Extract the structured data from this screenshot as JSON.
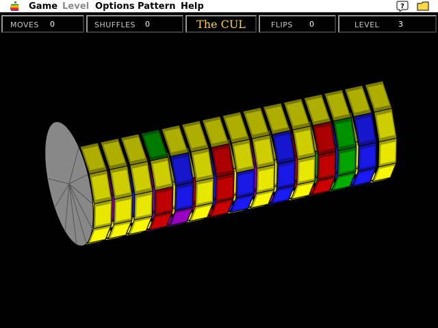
{
  "menubar": {
    "items": [
      {
        "label": "Game",
        "enabled": true
      },
      {
        "label": "Level",
        "enabled": false
      },
      {
        "label": "Options",
        "enabled": true
      },
      {
        "label": "Pattern",
        "enabled": true
      },
      {
        "label": "Help",
        "enabled": true
      }
    ],
    "right_icons": [
      "help-icon",
      "finder-icon"
    ]
  },
  "status": {
    "moves_label": "MOVES",
    "moves_value": "0",
    "shuffles_label": "SHUFFLES",
    "shuffles_value": "0",
    "title": "The CUL",
    "flips_label": "FLIPS",
    "flips_value": "0",
    "level_label": "LEVEL",
    "level_value": "3"
  },
  "colors": {
    "yellow": "#ffff00",
    "purple": "#9b00c8",
    "blue": "#1b1bff",
    "red": "#d20000",
    "green": "#00b400",
    "endcap": "#888888",
    "background": "#000000"
  },
  "cylinder": {
    "rings": [
      [
        "Y",
        "Y",
        "Y",
        "Y",
        "Y",
        "Y",
        "Y",
        "Y"
      ],
      [
        "Y",
        "Y",
        "Y",
        "Y",
        "Y",
        "Y",
        "Y",
        "Y"
      ],
      [
        "P",
        "P",
        "Y",
        "Y",
        "Y",
        "Y",
        "Y",
        "Y"
      ],
      [
        "B",
        "B",
        "Y",
        "P",
        "R",
        "R",
        "Y",
        "G"
      ],
      [
        "P",
        "P",
        "P",
        "P",
        "P",
        "B",
        "B",
        "Y"
      ],
      [
        "Y",
        "Y",
        "Y",
        "Y",
        "Y",
        "Y",
        "Y",
        "Y"
      ],
      [
        "Y",
        "R",
        "R",
        "R",
        "R",
        "R",
        "R",
        "Y"
      ],
      [
        "B",
        "B",
        "B",
        "Y",
        "B",
        "B",
        "Y",
        "Y"
      ],
      [
        "Y",
        "Y",
        "Y",
        "Y",
        "Y",
        "Y",
        "Y",
        "Y"
      ],
      [
        "P",
        "P",
        "P",
        "B",
        "B",
        "B",
        "B",
        "Y"
      ],
      [
        "Y",
        "Y",
        "Y",
        "Y",
        "Y",
        "Y",
        "Y",
        "Y"
      ],
      [
        "R",
        "R",
        "R",
        "R",
        "R",
        "R",
        "R",
        "Y"
      ],
      [
        "Y",
        "G",
        "G",
        "G",
        "G",
        "G",
        "G",
        "Y"
      ],
      [
        "B",
        "B",
        "B",
        "B",
        "B",
        "B",
        "B",
        "Y"
      ],
      [
        "Y",
        "Y",
        "Y",
        "Y",
        "Y",
        "Y",
        "Y",
        "Y"
      ]
    ]
  }
}
